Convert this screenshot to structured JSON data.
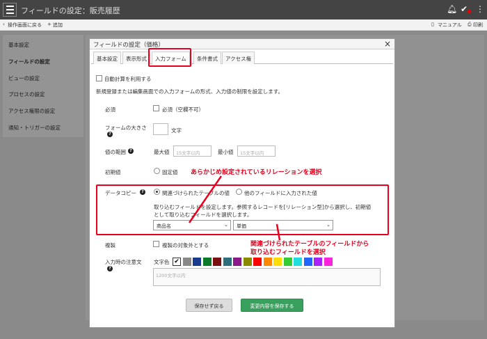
{
  "app": {
    "title": "フィールドの設定：販売履歴"
  },
  "subbar": {
    "back_label": "操作画面に戻る",
    "add_label": "追加",
    "manual_label": "マニュアル",
    "print_label": "印刷"
  },
  "left_nav": {
    "items": [
      {
        "label": "基本設定"
      },
      {
        "label": "フィールドの設定"
      },
      {
        "label": "ビューの設定"
      },
      {
        "label": "プロセスの設定"
      },
      {
        "label": "アクセス権限の設定"
      },
      {
        "label": "通知・トリガーの設定"
      }
    ]
  },
  "modal": {
    "title": "フィールドの設定（価格）",
    "tabs": [
      {
        "label": "基本設定"
      },
      {
        "label": "表示形式"
      },
      {
        "label": "入力フォーム"
      },
      {
        "label": "条件書式"
      },
      {
        "label": "アクセス権"
      }
    ],
    "auto_calc_label": "自動計算を利用する",
    "description": "新規登録または編集画面での入力フォームの形式、入力値の制限を設定します。",
    "required": {
      "label": "必須",
      "checkbox_label": "必須（空欄不可）"
    },
    "form_size": {
      "label": "フォームの大きさ",
      "unit": "文字"
    },
    "value_range": {
      "label": "値の範囲",
      "max_label": "最大値",
      "max_placeholder": "15文字以内",
      "min_label": "最小値",
      "min_placeholder": "15文字以内"
    },
    "initial_value": {
      "label": "初期値",
      "option": "固定値"
    },
    "data_copy": {
      "label": "データコピー",
      "option_related": "関連づけられたテーブルの値",
      "option_other": "他のフィールドに入力された値",
      "desc_line1": "取り込むフィールドを設定します。参照するレコードを[リレーション型]から選択し、初期値",
      "desc_line2": "として取り込むフィールドを選択します。",
      "relation_value": "商品名",
      "field_value": "単価"
    },
    "duplicate": {
      "label": "複製",
      "checkbox_label": "複製の対象外とする"
    },
    "input_note": {
      "label": "入力時の注意文",
      "color_label": "文字色",
      "placeholder": "1200文字以内",
      "colors": [
        "#ffffff",
        "#888888",
        "#1a3a8f",
        "#0a7a2a",
        "#7a1010",
        "#2a6f7a",
        "#8a1a8a",
        "#8a8a00",
        "#ff0000",
        "#ff8800",
        "#ffdd00",
        "#33cc33",
        "#22dddd",
        "#2266ff",
        "#aa22ff",
        "#ff22dd"
      ]
    },
    "buttons": {
      "cancel": "保存せず戻る",
      "save": "変更内容を保存する"
    }
  },
  "annotations": {
    "relation_note": "あらかじめ設定されているリレーションを選択",
    "field_note_line1": "関連づけられたテーブルのフィールドから",
    "field_note_line2": "取り込むフィールドを選択"
  }
}
